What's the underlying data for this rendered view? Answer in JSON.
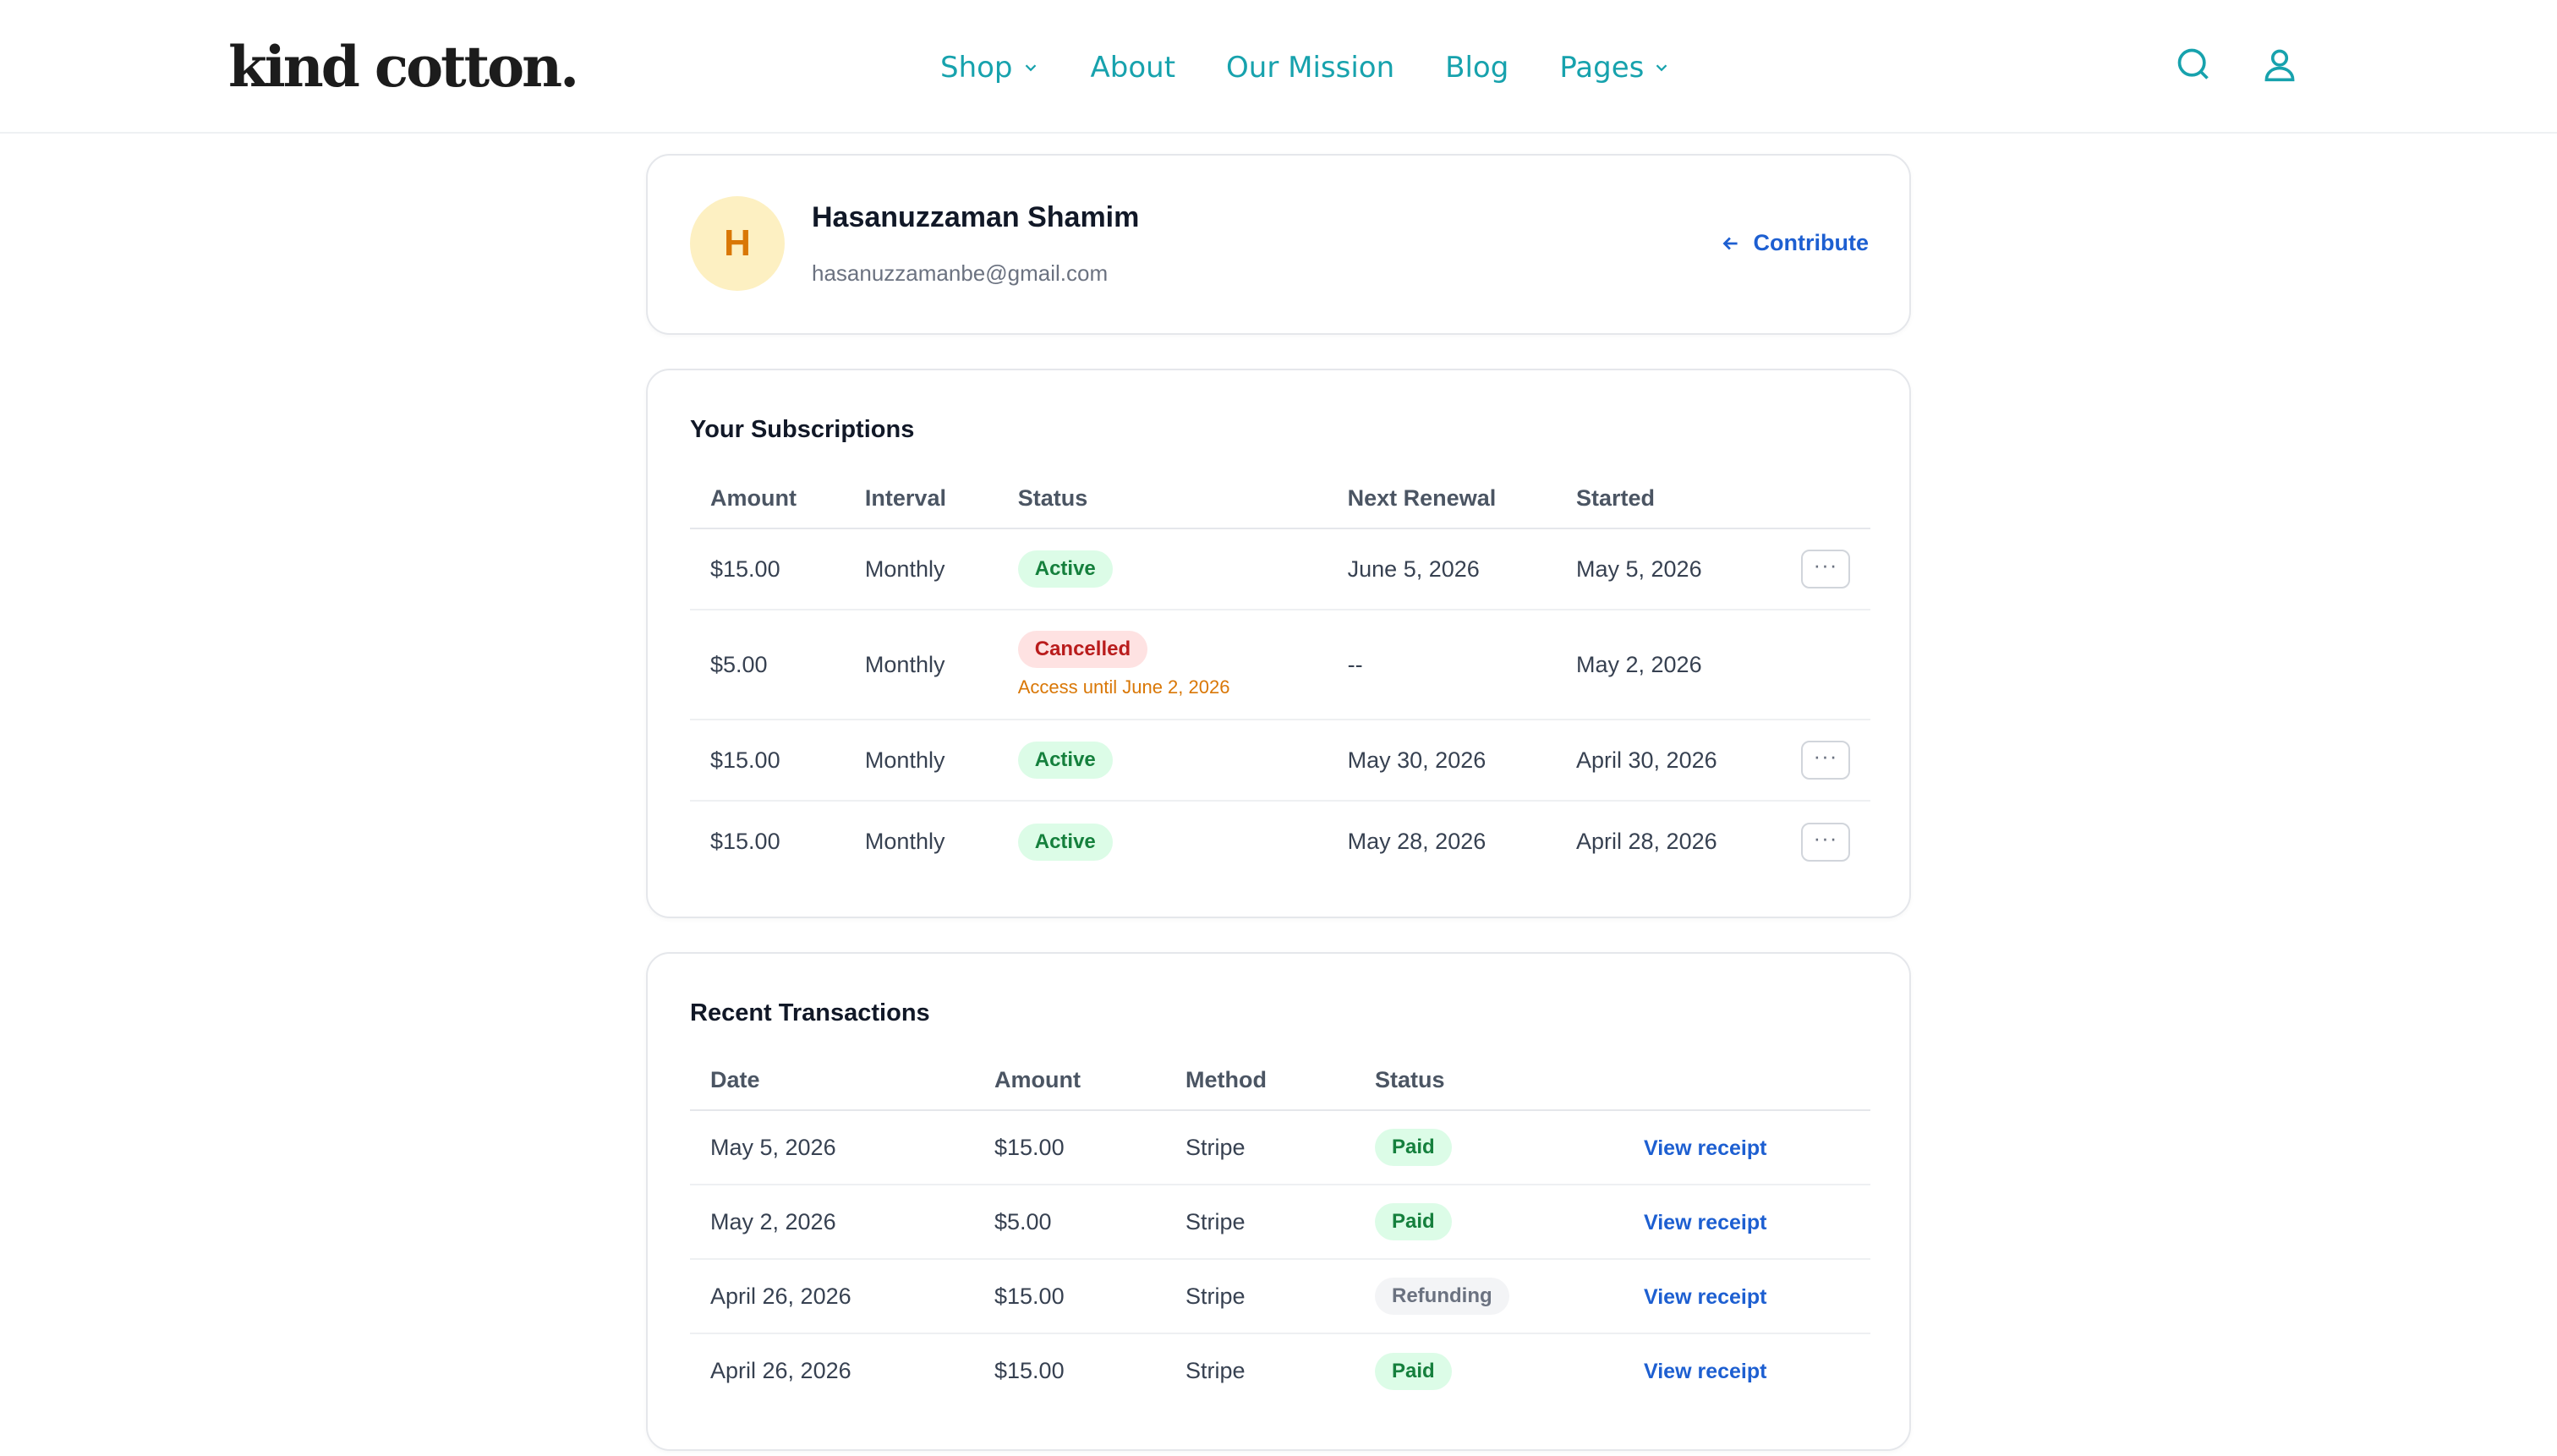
{
  "header": {
    "logo": "kind cotton.",
    "nav": [
      {
        "label": "Shop",
        "has_dropdown": true
      },
      {
        "label": "About",
        "has_dropdown": false
      },
      {
        "label": "Our Mission",
        "has_dropdown": false
      },
      {
        "label": "Blog",
        "has_dropdown": false
      },
      {
        "label": "Pages",
        "has_dropdown": true
      }
    ],
    "icons": [
      "search-icon",
      "user-icon"
    ],
    "accent_color": "#17a2ad"
  },
  "profile": {
    "initial": "H",
    "name": "Hasanuzzaman Shamim",
    "email": "hasanuzzamanbe@gmail.com",
    "contribute_label": "Contribute"
  },
  "subscriptions": {
    "title": "Your Subscriptions",
    "columns": [
      "Amount",
      "Interval",
      "Status",
      "Next Renewal",
      "Started"
    ],
    "rows": [
      {
        "amount": "$15.00",
        "interval": "Monthly",
        "status": "Active",
        "note": "",
        "next_renewal": "June 5, 2026",
        "started": "May 5, 2026",
        "has_menu": true
      },
      {
        "amount": "$5.00",
        "interval": "Monthly",
        "status": "Cancelled",
        "note": "Access until June 2, 2026",
        "next_renewal": "--",
        "started": "May 2, 2026",
        "has_menu": false
      },
      {
        "amount": "$15.00",
        "interval": "Monthly",
        "status": "Active",
        "note": "",
        "next_renewal": "May 30, 2026",
        "started": "April 30, 2026",
        "has_menu": true
      },
      {
        "amount": "$15.00",
        "interval": "Monthly",
        "status": "Active",
        "note": "",
        "next_renewal": "May 28, 2026",
        "started": "April 28, 2026",
        "has_menu": true
      }
    ],
    "menu_label": "···"
  },
  "transactions": {
    "title": "Recent Transactions",
    "columns": [
      "Date",
      "Amount",
      "Method",
      "Status"
    ],
    "rows": [
      {
        "date": "May 5, 2026",
        "amount": "$15.00",
        "method": "Stripe",
        "status": "Paid",
        "link": "View receipt"
      },
      {
        "date": "May 2, 2026",
        "amount": "$5.00",
        "method": "Stripe",
        "status": "Paid",
        "link": "View receipt"
      },
      {
        "date": "April 26, 2026",
        "amount": "$15.00",
        "method": "Stripe",
        "status": "Refunding",
        "link": "View receipt"
      },
      {
        "date": "April 26, 2026",
        "amount": "$15.00",
        "method": "Stripe",
        "status": "Paid",
        "link": "View receipt"
      }
    ]
  }
}
